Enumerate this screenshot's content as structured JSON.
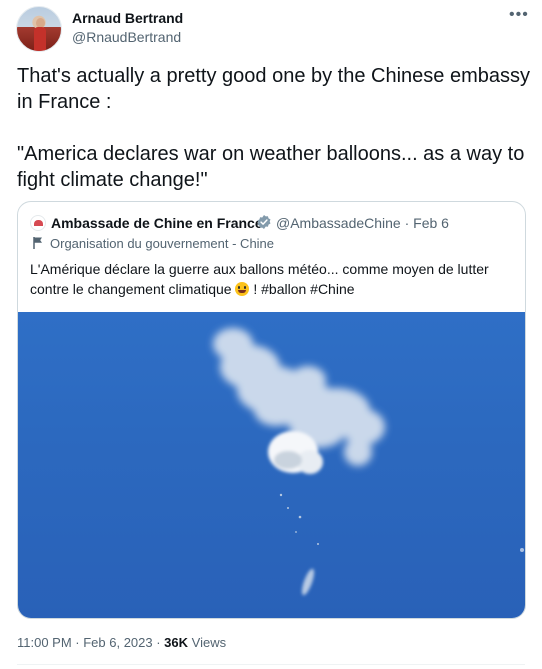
{
  "author": {
    "display_name": "Arnaud Bertrand",
    "handle": "@RnaudBertrand"
  },
  "tweet": {
    "paragraphs": [
      "That's actually a pretty good one by the Chinese embassy in France :",
      "\"America declares war on weather balloons... as a way to fight climate change!\""
    ]
  },
  "quote": {
    "display_name": "Ambassade de Chine en France",
    "handle_date": "@AmbassadeChine · Feb 6",
    "affiliation": "Organisation du gouvernement - Chine",
    "text_before_emoji": "L'Amérique déclare la guerre aux ballons météo... comme moyen de lutter contre le changement climatique",
    "text_after_emoji": "! #ballon #Chine"
  },
  "footer": {
    "timestamp": "11:00 PM · Feb 6, 2023 · ",
    "views_count": "36K",
    "views_label": " Views"
  },
  "icons": {
    "more": "more-options-icon",
    "verified": "verified-badge-icon",
    "flag": "flag-icon",
    "emoji": "grinning-face-emoji"
  },
  "colors": {
    "text_primary": "#0f1419",
    "text_secondary": "#536471",
    "verified_gray": "#829aab",
    "border": "#cfd9de",
    "sky": "#2c69bf"
  }
}
